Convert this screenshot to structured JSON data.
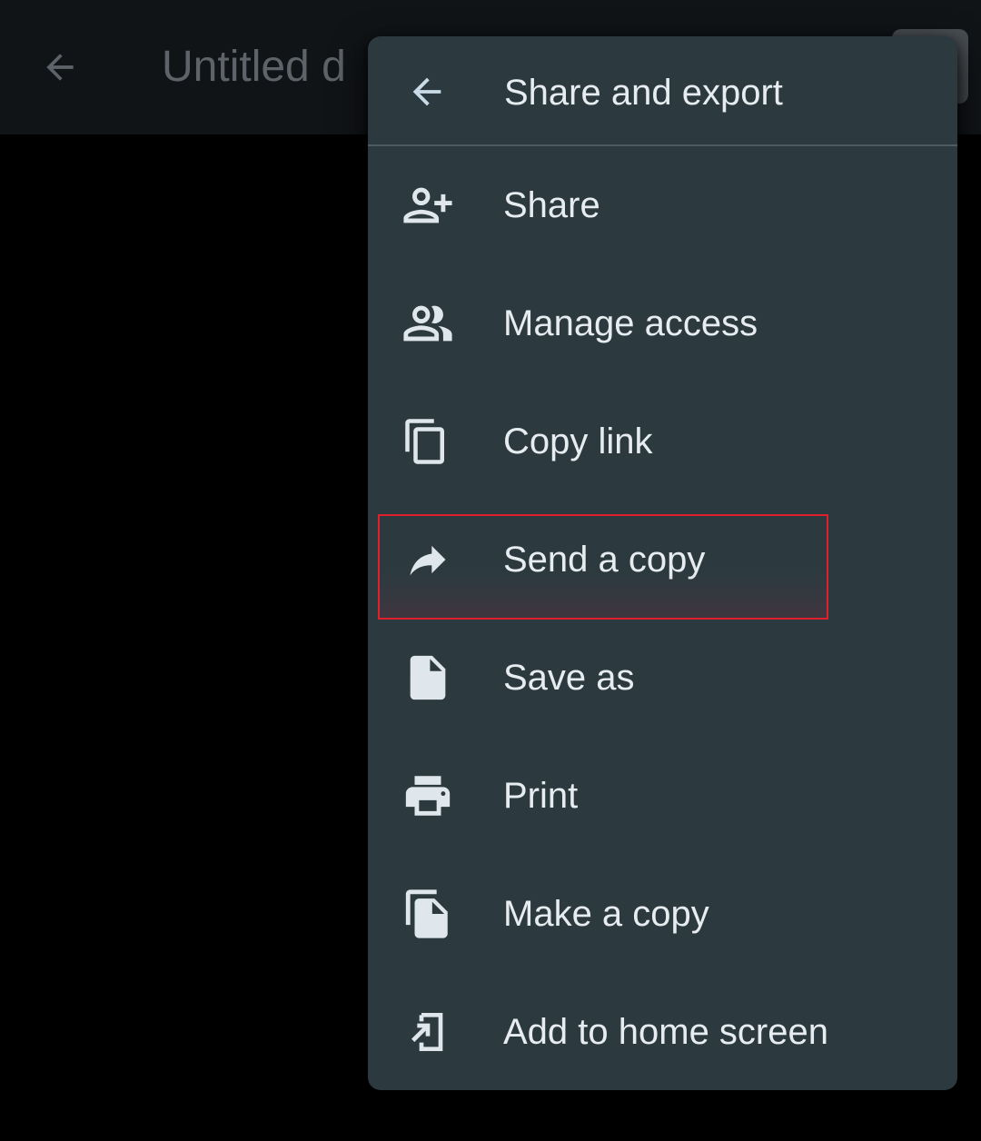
{
  "app_bar": {
    "title": "Untitled d",
    "back_icon": "arrow-back-icon"
  },
  "menu": {
    "title": "Share and export",
    "back_icon": "arrow-back-icon",
    "items": [
      {
        "label": "Share",
        "icon": "person-add-icon"
      },
      {
        "label": "Manage access",
        "icon": "people-icon"
      },
      {
        "label": "Copy link",
        "icon": "copy-link-icon"
      },
      {
        "label": "Send a copy",
        "icon": "share-forward-icon"
      },
      {
        "label": "Save as",
        "icon": "file-icon"
      },
      {
        "label": "Print",
        "icon": "print-icon"
      },
      {
        "label": "Make a copy",
        "icon": "file-copy-icon"
      },
      {
        "label": "Add to home screen",
        "icon": "add-to-home-icon"
      }
    ]
  },
  "colors": {
    "menu_background": "#2c3a40",
    "menu_text": "#e6ecef",
    "highlight_border": "#e0202c"
  }
}
